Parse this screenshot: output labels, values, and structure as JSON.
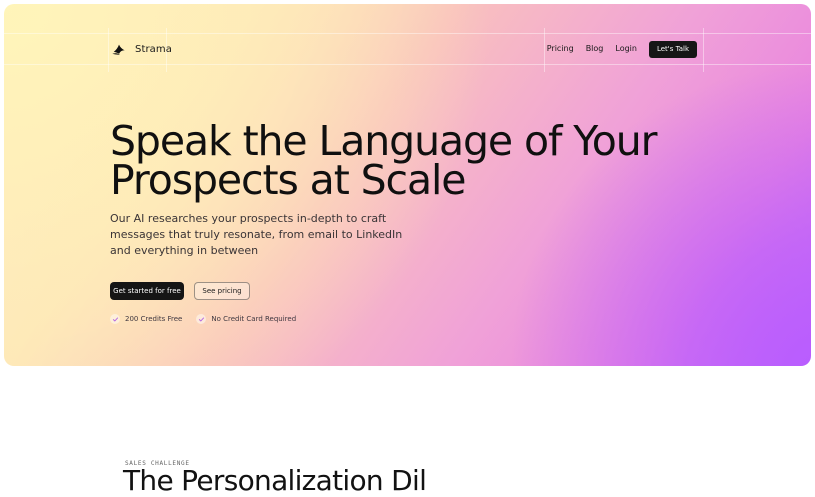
{
  "header": {
    "brand": "Strama",
    "nav": [
      "Pricing",
      "Blog",
      "Login"
    ],
    "cta": "Let's Talk"
  },
  "hero": {
    "title_line1": "Speak the Language of Your",
    "title_line2": "Prospects at Scale",
    "description": "Our AI researches your prospects in-depth to craft messages that truly resonate, from email to LinkedIn and everything in between",
    "primary_cta": "Get started for free",
    "secondary_cta": "See pricing",
    "features": [
      "200 Credits Free",
      "No Credit Card Required"
    ]
  },
  "section": {
    "eyebrow": "SALES CHALLENGE",
    "title": "The Personalization Dil"
  },
  "colors": {
    "text": "#101010",
    "button": "#151515",
    "hero_gradient": [
      "#fff0c4",
      "#f9c1be",
      "#e985df",
      "#c96df3"
    ]
  }
}
